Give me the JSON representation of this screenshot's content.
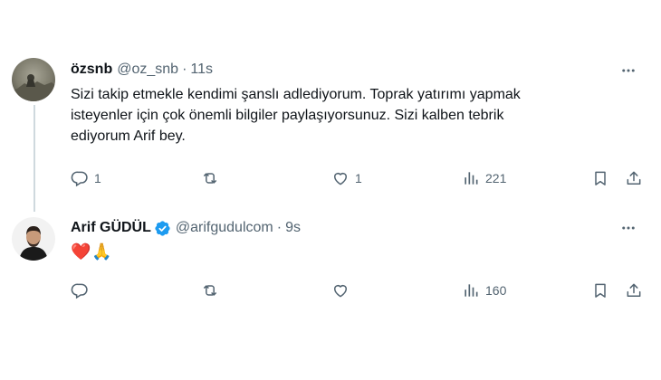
{
  "reply": {
    "display_name": "özsnb",
    "handle": "@oz_snb",
    "separator": "·",
    "time": "11s",
    "text_lines": [
      "Sizi takip etmekle kendimi şanslı adlediyorum. Toprak yatırımı yapmak",
      "isteyenler için çok önemli bilgiler paylaşıyorsunuz. Sizi kalben tebrik",
      "ediyorum Arif bey."
    ],
    "stats": {
      "replies": "1",
      "retweets": "",
      "likes": "1",
      "views": "221"
    }
  },
  "response": {
    "display_name": "Arif GÜDÜL",
    "handle": "@arifgudulcom",
    "separator": "·",
    "time": "9s",
    "emojis": [
      "❤️",
      "🙏"
    ],
    "stats": {
      "replies": "",
      "retweets": "",
      "likes": "",
      "views": "160"
    }
  },
  "colors": {
    "verified": "#1d9bf0",
    "heart": "#f91880",
    "text_secondary": "#536471",
    "thread_line": "#cfd9de"
  },
  "icons": [
    "reply-icon",
    "retweet-icon",
    "like-icon",
    "views-icon",
    "bookmark-icon",
    "share-icon",
    "more-icon",
    "verified-icon"
  ]
}
